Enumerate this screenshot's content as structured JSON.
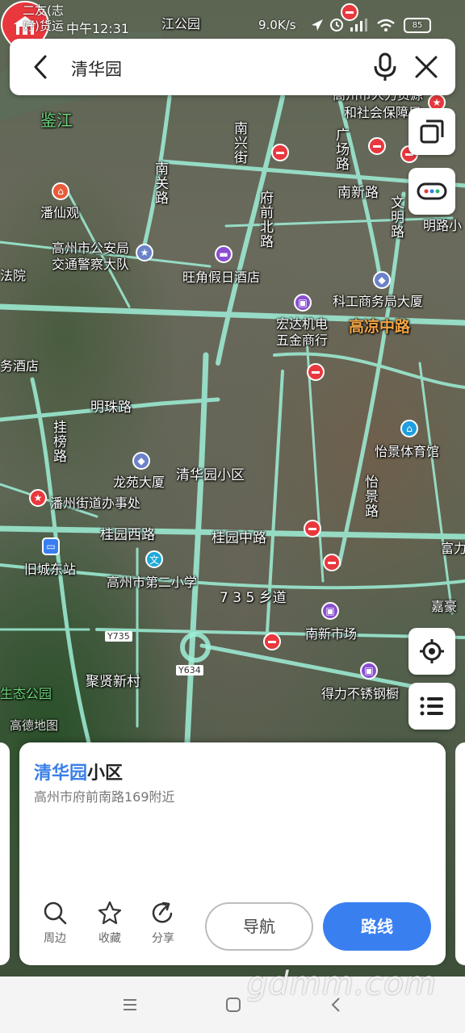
{
  "status_bar": {
    "carrier_line1": "二友(志",
    "carrier_line2": "好)货运",
    "time": "中午12:31",
    "net_speed": "9.0K/s",
    "battery": "85"
  },
  "search": {
    "query": "清华园"
  },
  "map": {
    "labels": {
      "jian_jiang": "鉴江",
      "nanguan_rd": "南关路",
      "nanxing_st": "南兴街",
      "fuqianbei_rd": "府前北路",
      "guangchang_rd": "广场路",
      "nanxin_rd": "南新路",
      "wenming_rd": "文明路",
      "mingluxiao": "明路小",
      "hr_bureau_1": "高州市人力资源",
      "hr_bureau_2": "和社会保障局",
      "panxian_temple": "潘仙观",
      "police_1": "高州市公安局",
      "police_2": "交通警察大队",
      "fayuan": "法院",
      "wangjiao_hotel": "旺角假日酒店",
      "kegong_bldg": "科工商务局大厦",
      "hongda_1": "宏达机电",
      "hongda_2": "五金商行",
      "gaoliang_rd": "高凉中路",
      "wu_hotel": "务酒店",
      "mingzhu_rd": "明珠路",
      "guabang_rd": "挂榜路",
      "yijing_gym": "怡景体育馆",
      "yijing_rd": "怡景路",
      "longyuan_bldg": "龙苑大厦",
      "community": "清华园小区",
      "panzhou_office": "潘州街道办事处",
      "guiyuan_west": "桂园西路",
      "guiyuan_mid": "桂园中路",
      "fuli": "富力",
      "jiuchengdong": "旧城东站",
      "school_2": "高州市第二小学",
      "road_735": "7 3 5 乡道",
      "nanxin_market": "南新市场",
      "jiahao": "嘉豪",
      "y735": "Y735",
      "y634": "Y634",
      "juxian_village": "聚贤新村",
      "delibuxiu": "得力不锈钢橱",
      "eco_park": "生态公园",
      "gaode_logo": "高德地图",
      "jianggong": "江公园"
    }
  },
  "card": {
    "title_highlight": "清华园",
    "title_rest": "小区",
    "address": "高州市府前南路169附近",
    "actions": {
      "nearby": "周边",
      "favorite": "收藏",
      "share": "分享"
    },
    "navigate": "导航",
    "route": "路线"
  },
  "watermark": "gdmm.com",
  "colors": {
    "accent_blue": "#3a7ff0",
    "marker_red": "#e8383d",
    "road_glow": "#9ff0d8"
  }
}
